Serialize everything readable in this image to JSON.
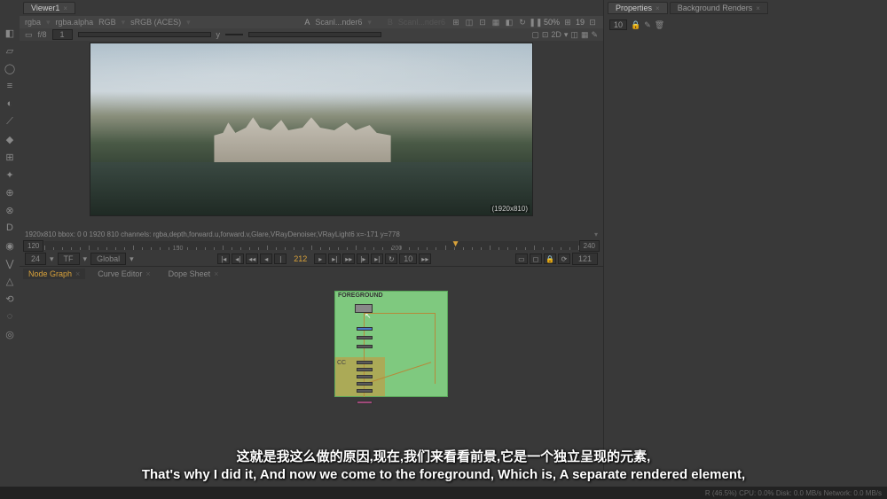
{
  "left_tools": [
    "◧",
    "▱",
    "◯",
    "≡",
    "◐",
    "⟋",
    "◆",
    "⊞",
    "✦",
    "⊕",
    "⊗",
    "D",
    "◉",
    "⋁",
    "△",
    "⟲",
    "◌",
    "◎"
  ],
  "viewer": {
    "tab": "Viewer1",
    "channels": "rgba",
    "layer": "rgba.alpha",
    "rgb": "RGB",
    "colorspace": "sRGB (ACES)",
    "inputA_label": "A",
    "inputA_value": "Scanl...nder6",
    "inputB_label": "B",
    "inputB_value": "Scanl...nder6",
    "zoom": "50%",
    "fps_readout": "19",
    "f_label": "f/8",
    "f_val": "1",
    "y_label": "y",
    "mode2d": "2D",
    "dim": "(1920x810)",
    "info": "1920x810  bbox: 0 0 1920 810 channels: rgba,depth,forward.u,forward.v,Glare,VRayDenoiser,VRayLight6    x=-171 y=778"
  },
  "timeline": {
    "start": "120",
    "end": "240",
    "end2": "121",
    "ticks": [
      "150",
      "200"
    ],
    "caret_pos_pct": 77
  },
  "playback": {
    "fps": "24",
    "tf": "TF",
    "scope": "Global",
    "current": "212",
    "inc": "10"
  },
  "nodegraph": {
    "tab1": "Node Graph",
    "tab2": "Curve Editor",
    "tab3": "Dope Sheet",
    "backdrop_label": "FOREGROUND",
    "cc_label": "CC"
  },
  "right_panel": {
    "tab1": "Properties",
    "tab2": "Background Renders",
    "count": "10"
  },
  "subtitles": {
    "line1": "这就是我这么做的原因,现在,我们来看看前景,它是一个独立呈现的元素,",
    "line2": "That's why I did it, And now we come to the foreground, Which is, A separate rendered element,"
  },
  "status": {
    "right": "R (46.5%) CPU: 0.0% Disk: 0.0 MB/s Network: 0.0 MB/s"
  }
}
